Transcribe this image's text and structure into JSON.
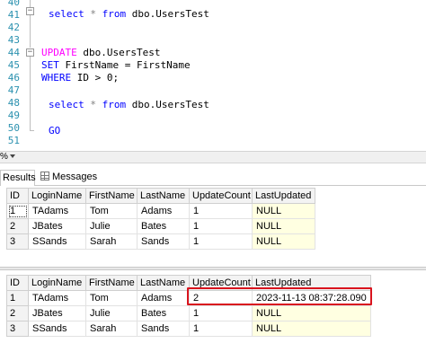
{
  "editor": {
    "line_numbers": [
      "40",
      "41",
      "42",
      "43",
      "44",
      "45",
      "46",
      "47",
      "48",
      "49",
      "50",
      "51"
    ],
    "line40": {
      "kw1": "select",
      "op": "*",
      "kw2": "from",
      "obj": "dbo.UsersTest"
    },
    "line44": {
      "kw": "UPDATE",
      "obj": "dbo.UsersTest"
    },
    "line45": {
      "kw": "SET",
      "text": "FirstName = FirstName"
    },
    "line46": {
      "kw": "WHERE",
      "text": "ID > 0;"
    },
    "line48": {
      "kw1": "select",
      "op": "*",
      "kw2": "from",
      "obj": "dbo.UsersTest"
    },
    "line50": {
      "kw": "GO"
    }
  },
  "zoom": {
    "value": "%"
  },
  "tabs": {
    "results": "Results",
    "messages": "Messages"
  },
  "grid_columns": [
    "ID",
    "LoginName",
    "FirstName",
    "LastName",
    "UpdateCount",
    "LastUpdated"
  ],
  "grid1": {
    "rows": [
      [
        "1",
        "TAdams",
        "Tom",
        "Adams",
        "1",
        "NULL"
      ],
      [
        "2",
        "JBates",
        "Julie",
        "Bates",
        "1",
        "NULL"
      ],
      [
        "3",
        "SSands",
        "Sarah",
        "Sands",
        "1",
        "NULL"
      ]
    ]
  },
  "grid2": {
    "rows": [
      [
        "1",
        "TAdams",
        "Tom",
        "Adams",
        "2",
        "2023-11-13 08:37:28.090"
      ],
      [
        "2",
        "JBates",
        "Julie",
        "Bates",
        "1",
        "NULL"
      ],
      [
        "3",
        "SSands",
        "Sarah",
        "Sands",
        "1",
        "NULL"
      ]
    ]
  },
  "colors": {
    "keyword": "#0000ff",
    "line_number": "#2b91af",
    "null_cell": "#ffffe1",
    "highlight_box": "#d9141e"
  }
}
